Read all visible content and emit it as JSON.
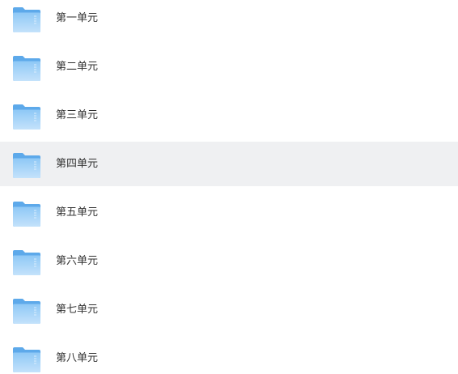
{
  "folders": [
    {
      "name": "第一单元",
      "icon": "folder-icon",
      "selected": false
    },
    {
      "name": "第二单元",
      "icon": "folder-icon",
      "selected": false
    },
    {
      "name": "第三单元",
      "icon": "folder-icon",
      "selected": false
    },
    {
      "name": "第四单元",
      "icon": "folder-icon",
      "selected": true
    },
    {
      "name": "第五单元",
      "icon": "folder-icon",
      "selected": false
    },
    {
      "name": "第六单元",
      "icon": "folder-icon",
      "selected": false
    },
    {
      "name": "第七单元",
      "icon": "folder-icon",
      "selected": false
    },
    {
      "name": "第八单元",
      "icon": "folder-icon",
      "selected": false
    }
  ],
  "colors": {
    "selected_row_bg": "#eff0f2",
    "text": "#333333",
    "folder_back": "#5da9ea",
    "folder_front_top": "#8ec8f6",
    "folder_front_bottom": "#c4e2fb"
  }
}
